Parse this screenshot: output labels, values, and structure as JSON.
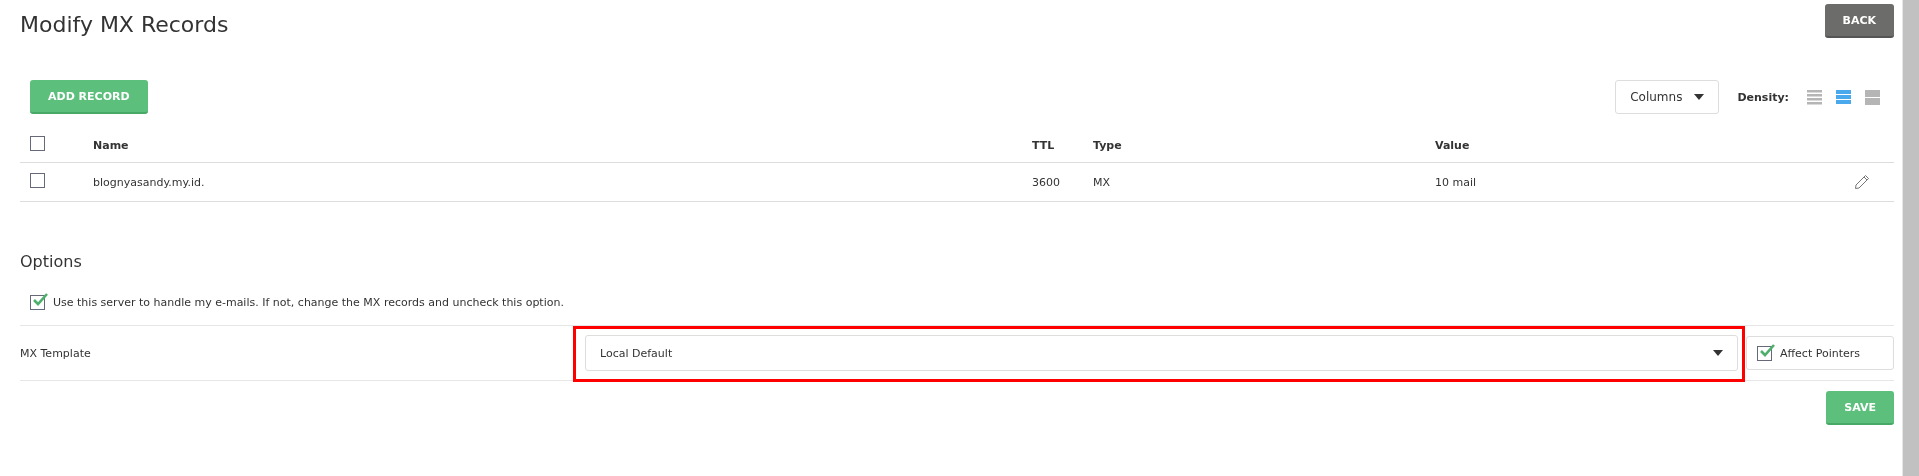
{
  "page": {
    "title": "Modify MX Records",
    "back_button": "BACK"
  },
  "toolbar": {
    "add_button": "ADD RECORD",
    "columns_button": "Columns",
    "density_label": "Density:",
    "density_options": [
      {
        "kind": "compact",
        "selected": false
      },
      {
        "kind": "normal",
        "selected": true
      },
      {
        "kind": "wide",
        "selected": false
      }
    ]
  },
  "table": {
    "select_all": {
      "checked": false
    },
    "columns": [
      {
        "kind": "name",
        "label": "Name"
      },
      {
        "kind": "ttl",
        "label": "TTL"
      },
      {
        "kind": "type",
        "label": "Type"
      },
      {
        "kind": "value",
        "label": "Value"
      }
    ],
    "rows": [
      {
        "checked": false,
        "name": "blognyasandy.my.id.",
        "ttl": "3600",
        "type": "MX",
        "value": "10 mail"
      }
    ]
  },
  "options": {
    "title": "Options",
    "use_server": {
      "checked": true,
      "label": "Use this server to handle my e-mails. If not, change the MX records and uncheck this option."
    },
    "mx_template": {
      "label": "MX Template",
      "value": "Local Default",
      "highlighted": true,
      "affect_pointers": {
        "checked": true,
        "label": "Affect Pointers"
      }
    },
    "save_button": "SAVE"
  }
}
